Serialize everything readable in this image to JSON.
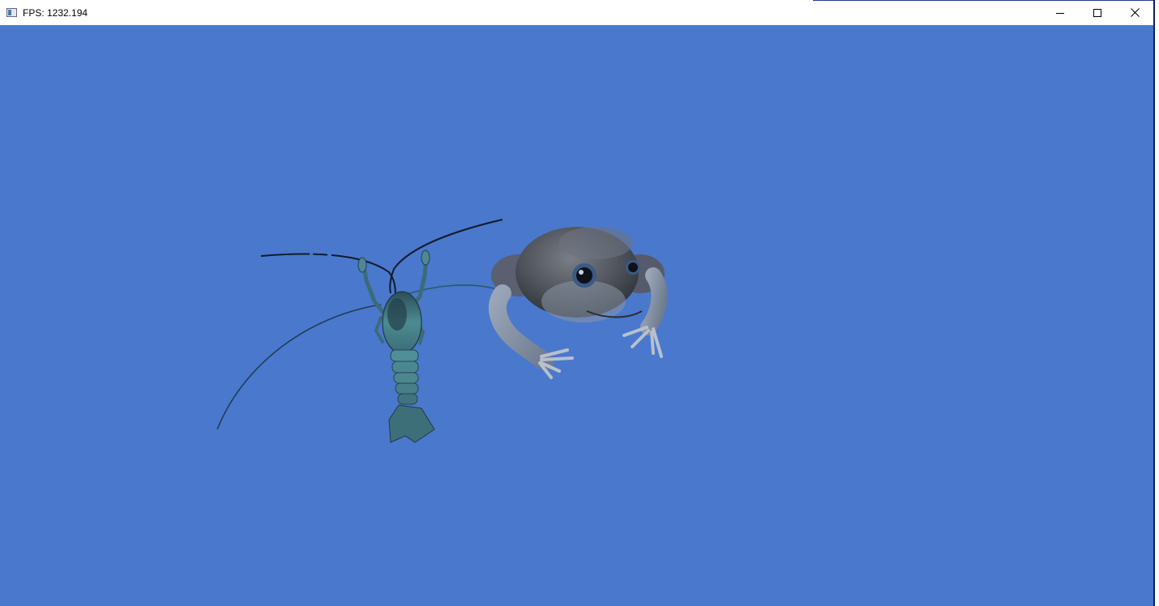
{
  "window": {
    "title": "FPS: 1232.194",
    "controls": {
      "minimize_icon": "minimize-icon",
      "maximize_icon": "maximize-icon",
      "close_icon": "close-icon"
    }
  },
  "scene": {
    "background_color": "#4a78cc",
    "objects": [
      "crayfish-model",
      "toad-model"
    ]
  }
}
